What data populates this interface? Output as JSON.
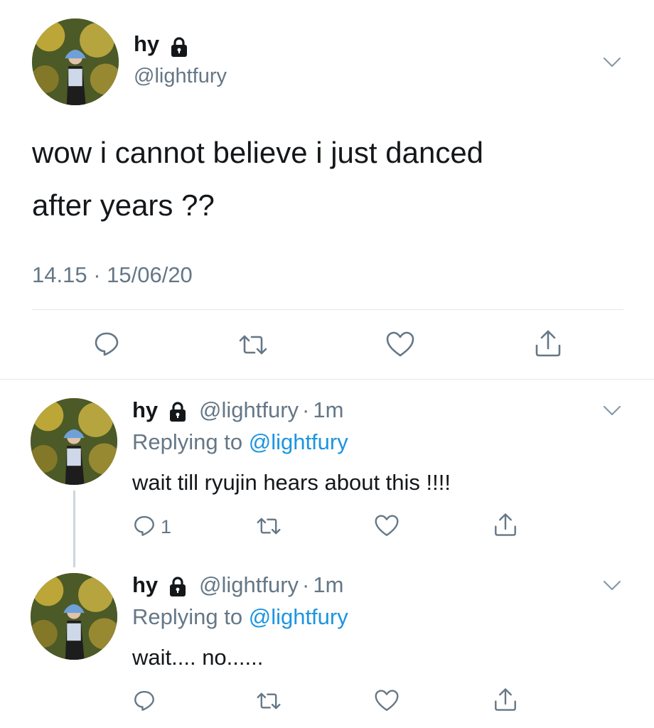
{
  "main_tweet": {
    "display_name": "hy",
    "handle": "@lightfury",
    "text_line1": "wow i cannot believe i just danced",
    "text_line2": "after years ??",
    "timestamp": "14.15 · 15/06/20",
    "icons": {
      "lock": "lock-icon",
      "reply": "reply-icon",
      "retweet": "retweet-icon",
      "like": "like-icon",
      "share": "share-icon",
      "more": "chevron-down-icon"
    }
  },
  "replies": [
    {
      "display_name": "hy",
      "handle": "@lightfury",
      "separator": "·",
      "age": "1m",
      "replying_prefix": "Replying to",
      "replying_handle": "@lightfury",
      "text": "wait till ryujin hears about this !!!!",
      "reply_count": "1"
    },
    {
      "display_name": "hy",
      "handle": "@lightfury",
      "separator": "·",
      "age": "1m",
      "replying_prefix": "Replying to",
      "replying_handle": "@lightfury",
      "text": "wait.... no......",
      "reply_count": ""
    }
  ],
  "colors": {
    "text": "#14171a",
    "muted": "#657786",
    "link": "#1b95e0",
    "divider": "#e1e8ed"
  }
}
